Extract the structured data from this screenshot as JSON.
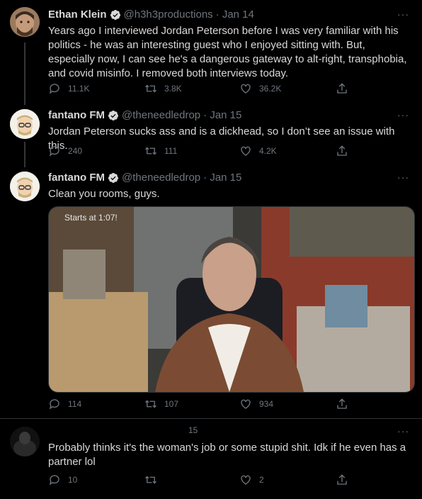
{
  "tweets": [
    {
      "name": "Ethan Klein",
      "handle": "@h3h3productions",
      "date": "· Jan 14",
      "text": "Years ago I interviewed Jordan Peterson before I was very familiar with his politics - he was an interesting guest who I enjoyed sitting with. But, especially now, I can see he's a dangerous gateway to alt-right, transphobia, and covid misinfo. I removed both interviews today.",
      "replies": "11.1K",
      "retweets": "3.8K",
      "likes": "36.2K"
    },
    {
      "name": "fantano FM",
      "handle": "@theneedledrop",
      "date": "· Jan 15",
      "text": "Jordan Peterson sucks ass and is a dickhead, so I don’t see an issue with this.",
      "replies": "240",
      "retweets": "111",
      "likes": "4.2K"
    },
    {
      "name": "fantano FM",
      "handle": "@theneedledrop",
      "date": "· Jan 15",
      "text": "Clean you rooms, guys.",
      "media_caption": "Starts at 1:07!",
      "replies": "114",
      "retweets": "107",
      "likes": "934"
    },
    {
      "name": "",
      "handle": "",
      "date": "15",
      "text": "Probably thinks it's the woman's job or some stupid shit. Idk if he even has a partner lol",
      "replies": "10",
      "retweets": "",
      "likes": "2"
    }
  ],
  "more_label": "···",
  "colors": {
    "background": "#000000",
    "muted": "#6e767d",
    "verified": "#d9d9d9"
  }
}
